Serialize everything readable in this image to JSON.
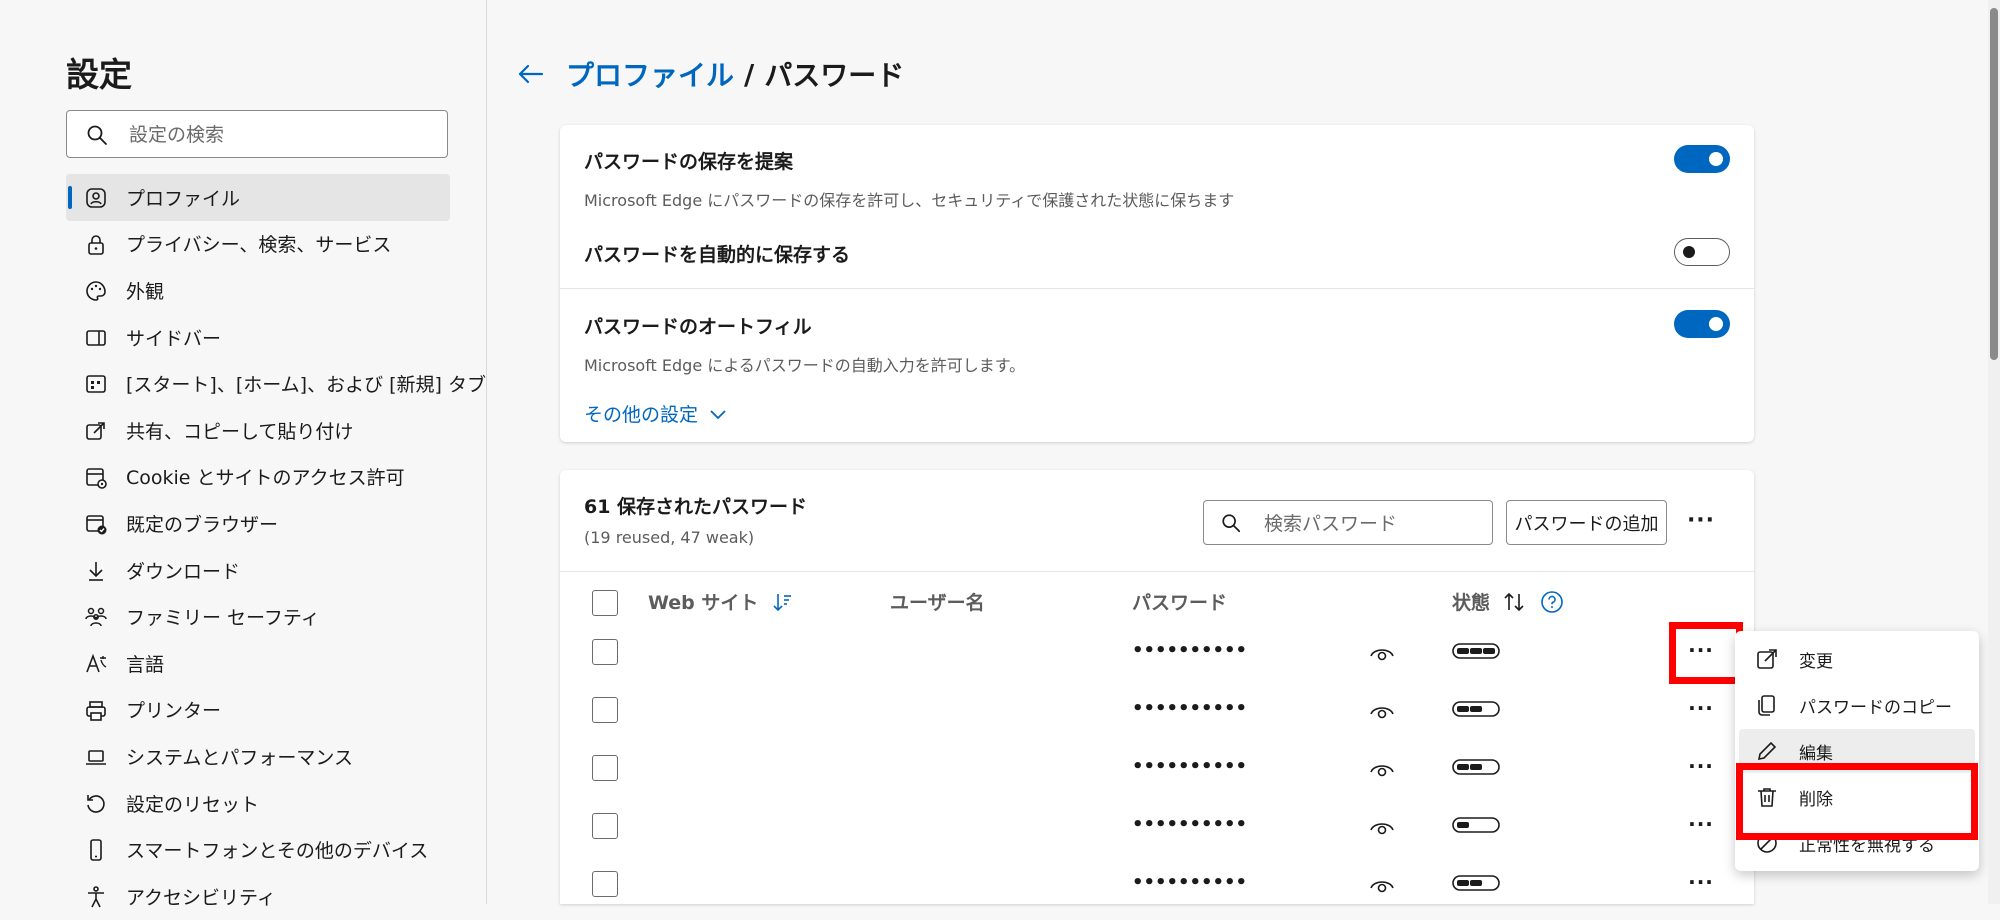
{
  "sidebar": {
    "title": "設定",
    "search_placeholder": "設定の検索",
    "items": [
      {
        "label": "プロファイル",
        "icon": "profile-icon",
        "active": true
      },
      {
        "label": "プライバシー、検索、サービス",
        "icon": "lock-icon"
      },
      {
        "label": "外観",
        "icon": "palette-icon"
      },
      {
        "label": "サイドバー",
        "icon": "sidebar-icon"
      },
      {
        "label": "[スタート]、[ホーム]、および [新規] タブ",
        "icon": "start-page-icon"
      },
      {
        "label": "共有、コピーして貼り付け",
        "icon": "share-icon"
      },
      {
        "label": "Cookie とサイトのアクセス許可",
        "icon": "cookie-icon"
      },
      {
        "label": "既定のブラウザー",
        "icon": "browser-icon"
      },
      {
        "label": "ダウンロード",
        "icon": "download-icon"
      },
      {
        "label": "ファミリー セーフティ",
        "icon": "family-icon"
      },
      {
        "label": "言語",
        "icon": "language-icon"
      },
      {
        "label": "プリンター",
        "icon": "printer-icon"
      },
      {
        "label": "システムとパフォーマンス",
        "icon": "laptop-icon"
      },
      {
        "label": "設定のリセット",
        "icon": "reset-icon"
      },
      {
        "label": "スマートフォンとその他のデバイス",
        "icon": "phone-icon"
      },
      {
        "label": "アクセシビリティ",
        "icon": "accessibility-icon"
      }
    ]
  },
  "header": {
    "breadcrumb_link": "プロファイル",
    "separator": "/",
    "current": "パスワード"
  },
  "settings": {
    "offer_save": {
      "title": "パスワードの保存を提案",
      "desc": "Microsoft Edge にパスワードの保存を許可し、セキュリティで保護された状態に保ちます",
      "on": true
    },
    "auto_save": {
      "title": "パスワードを自動的に保存する",
      "on": false
    },
    "autofill": {
      "title": "パスワードのオートフィル",
      "desc": "Microsoft Edge によるパスワードの自動入力を許可します。",
      "on": true
    },
    "more_settings": "その他の設定"
  },
  "passwords": {
    "count_title": "61 保存されたパスワード",
    "subtitle": "(19 reused, 47 weak)",
    "search_placeholder": "検索パスワード",
    "add_button": "パスワードの追加",
    "more": "···",
    "columns": {
      "website": "Web サイト",
      "username": "ユーザー名",
      "password": "パスワード",
      "status": "状態"
    },
    "rows": [
      {
        "password": "••••••••••",
        "strength": 3
      },
      {
        "password": "••••••••••",
        "strength": 2
      },
      {
        "password": "••••••••••",
        "strength": 2
      },
      {
        "password": "••••••••••",
        "strength": 1
      },
      {
        "password": "••••••••••",
        "strength": 2
      }
    ],
    "row_more": "···"
  },
  "context_menu": {
    "items": [
      {
        "label": "変更",
        "icon": "open-external-icon"
      },
      {
        "label": "パスワードのコピー",
        "icon": "copy-icon"
      },
      {
        "label": "編集",
        "icon": "pencil-icon"
      },
      {
        "label": "削除",
        "icon": "trash-icon"
      },
      {
        "label": "正常性を無視する",
        "icon": "block-icon"
      }
    ]
  },
  "colors": {
    "accent": "#0067c0",
    "highlight": "#ff0000"
  }
}
